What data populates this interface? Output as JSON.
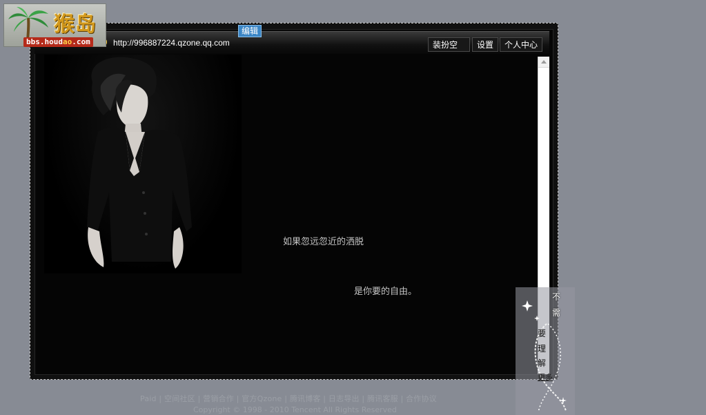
{
  "logo": {
    "title": "猴岛",
    "url_prefix": "bbs.houd",
    "url_highlight": "ao",
    "url_suffix": ".com"
  },
  "header": {
    "edit_label": "编辑",
    "space_url": "http://996887224.qzone.qq.com",
    "buttons": {
      "dress_label": "装扮空间",
      "settings_label": "设置",
      "center_label": "个人中心"
    }
  },
  "content": {
    "line1": "如果忽远忽近的洒脱",
    "line2": "是你要的自由。"
  },
  "widget": {
    "chars": [
      "不",
      "需",
      "要",
      "理",
      "解"
    ],
    "more_label": "更多"
  },
  "footer": {
    "links": "Paid | 空间社区 | 营销合作 | 官方Qzone | 腾讯博客 | 日志导出 | 腾讯客服 | 合作协议",
    "copyright": "Copyright © 1998 - 2010 Tencent All Rights Reserved"
  },
  "colors": {
    "background": "#878b94",
    "accent": "#3b86c6",
    "frame": "#060606"
  }
}
